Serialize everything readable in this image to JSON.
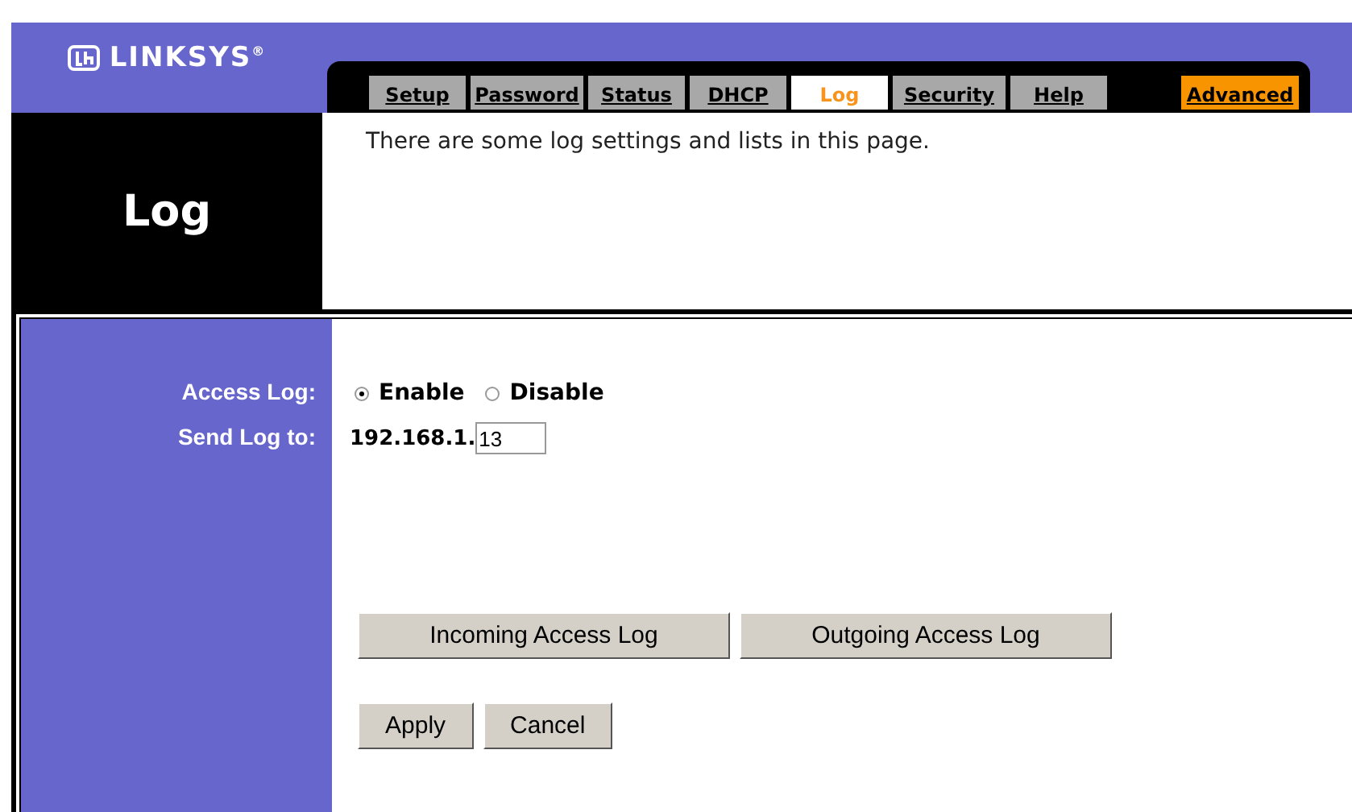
{
  "header": {
    "logo": "LINKSYS",
    "registered": "®"
  },
  "tabs": [
    {
      "label": "Setup",
      "selected": false,
      "kind": "normal"
    },
    {
      "label": "Password",
      "selected": false,
      "kind": "normal"
    },
    {
      "label": "Status",
      "selected": false,
      "kind": "normal"
    },
    {
      "label": "DHCP",
      "selected": false,
      "kind": "normal"
    },
    {
      "label": "Log",
      "selected": true,
      "kind": "normal"
    },
    {
      "label": "Security",
      "selected": false,
      "kind": "normal"
    },
    {
      "label": "Help",
      "selected": false,
      "kind": "normal"
    },
    {
      "label": "Advanced",
      "selected": false,
      "kind": "advanced"
    }
  ],
  "page_title": "Log",
  "description": "There are some log settings and lists in this page.",
  "form": {
    "access_log": {
      "label": "Access Log:",
      "options": [
        {
          "label": "Enable",
          "selected": true
        },
        {
          "label": "Disable",
          "selected": false
        }
      ]
    },
    "send_log_to": {
      "label": "Send Log to:",
      "prefix": "192.168.1.",
      "value": "13"
    }
  },
  "log_buttons": [
    "Incoming Access Log",
    "Outgoing Access Log"
  ],
  "buttons": [
    "Apply",
    "Cancel"
  ]
}
